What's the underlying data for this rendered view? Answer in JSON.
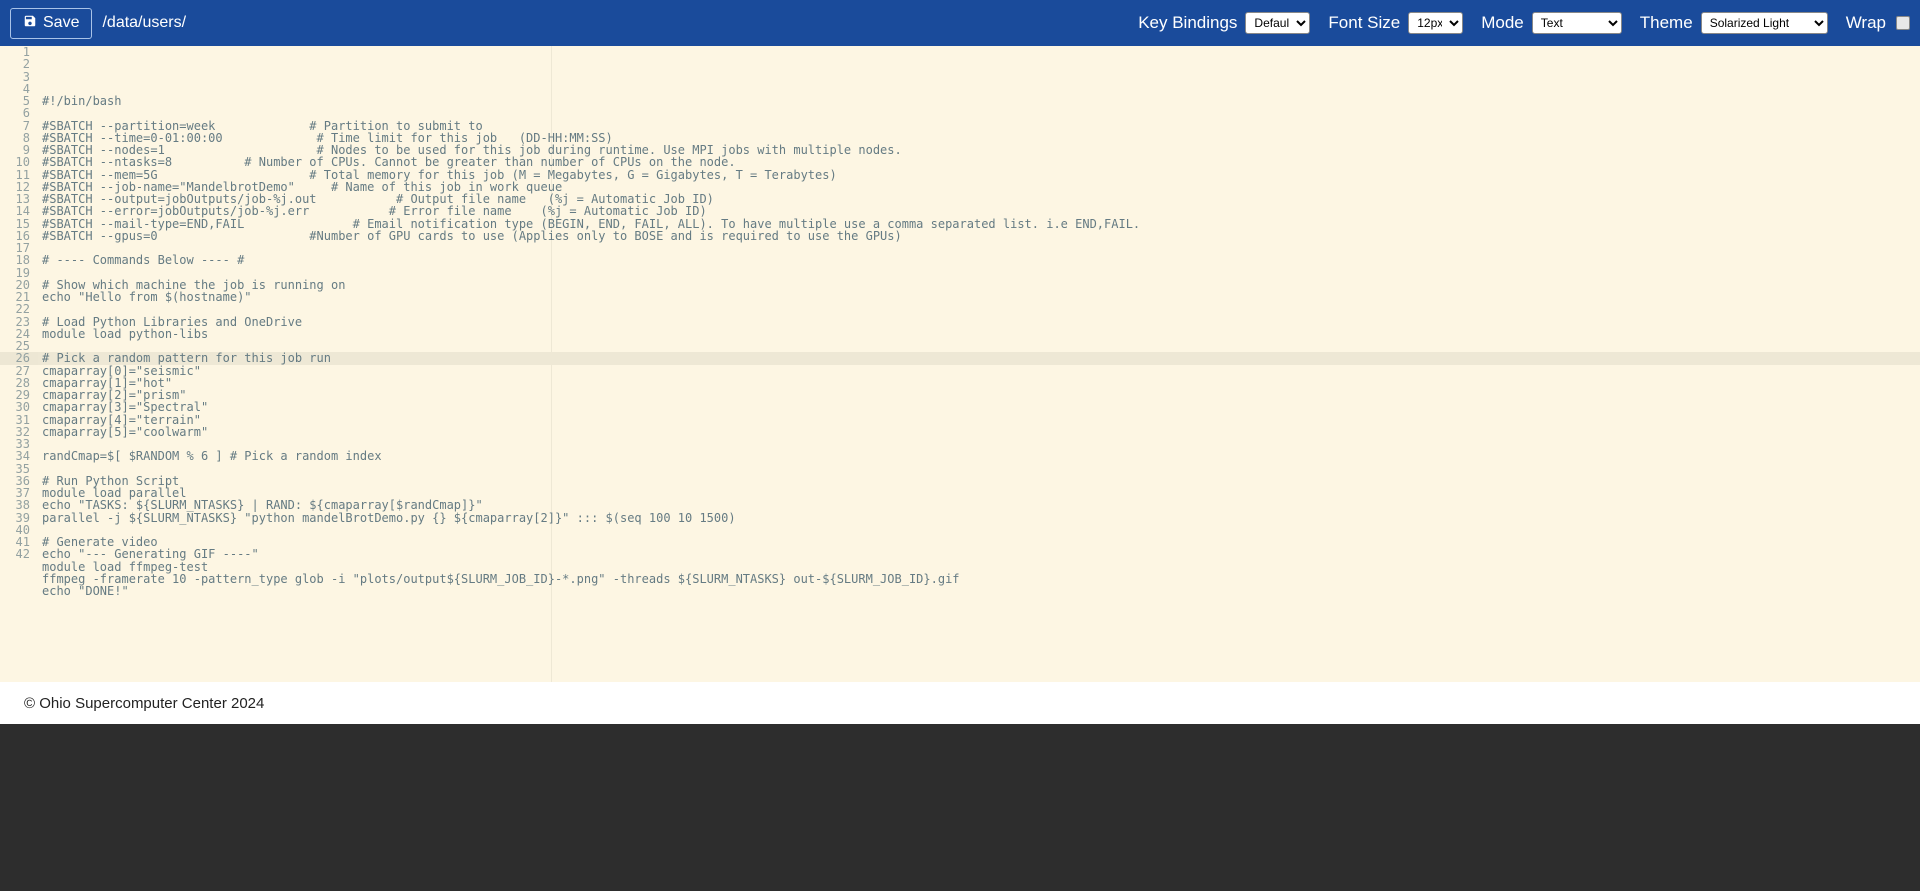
{
  "toolbar": {
    "save_label": "Save",
    "path_visible": "/data/users/",
    "path_dimmed": "",
    "key_bindings_label": "Key Bindings",
    "key_bindings_value": "Default",
    "font_size_label": "Font Size",
    "font_size_value": "12px",
    "mode_label": "Mode",
    "mode_value": "Text",
    "theme_label": "Theme",
    "theme_value": "Solarized Light",
    "wrap_label": "Wrap"
  },
  "editor": {
    "active_line": 26,
    "lines": [
      "#!/bin/bash",
      "",
      "#SBATCH --partition=week             # Partition to submit to",
      "#SBATCH --time=0-01:00:00             # Time limit for this job   (DD-HH:MM:SS)",
      "#SBATCH --nodes=1                     # Nodes to be used for this job during runtime. Use MPI jobs with multiple nodes.",
      "#SBATCH --ntasks=8          # Number of CPUs. Cannot be greater than number of CPUs on the node.",
      "#SBATCH --mem=5G                     # Total memory for this job (M = Megabytes, G = Gigabytes, T = Terabytes)",
      "#SBATCH --job-name=\"MandelbrotDemo\"     # Name of this job in work queue",
      "#SBATCH --output=jobOutputs/job-%j.out           # Output file name   (%j = Automatic Job ID)",
      "#SBATCH --error=jobOutputs/job-%j.err           # Error file name    (%j = Automatic Job ID)",
      "#SBATCH --mail-type=END,FAIL               # Email notification type (BEGIN, END, FAIL, ALL). To have multiple use a comma separated list. i.e END,FAIL.",
      "#SBATCH --gpus=0                     #Number of GPU cards to use (Applies only to BOSE and is required to use the GPUs)",
      "",
      "# ---- Commands Below ---- #",
      "",
      "# Show which machine the job is running on",
      "echo \"Hello from $(hostname)\"",
      "",
      "# Load Python Libraries and OneDrive",
      "module load python-libs",
      "",
      "# Pick a random pattern for this job run",
      "cmaparray[0]=\"seismic\"",
      "cmaparray[1]=\"hot\"",
      "cmaparray[2]=\"prism\"",
      "cmaparray[3]=\"Spectral\"",
      "cmaparray[4]=\"terrain\"",
      "cmaparray[5]=\"coolwarm\"",
      "",
      "randCmap=$[ $RANDOM % 6 ] # Pick a random index",
      "",
      "# Run Python Script",
      "module load parallel",
      "echo \"TASKS: ${SLURM_NTASKS} | RAND: ${cmaparray[$randCmap]}\"",
      "parallel -j ${SLURM_NTASKS} \"python mandelBrotDemo.py {} ${cmaparray[2]}\" ::: $(seq 100 10 1500)",
      "",
      "# Generate video",
      "echo \"--- Generating GIF ----\"",
      "module load ffmpeg-test",
      "ffmpeg -framerate 10 -pattern_type glob -i \"plots/output${SLURM_JOB_ID}-*.png\" -threads ${SLURM_NTASKS} out-${SLURM_JOB_ID}.gif",
      "echo \"DONE!\"",
      ""
    ]
  },
  "footer": {
    "copyright": "© Ohio Supercomputer Center 2024"
  }
}
